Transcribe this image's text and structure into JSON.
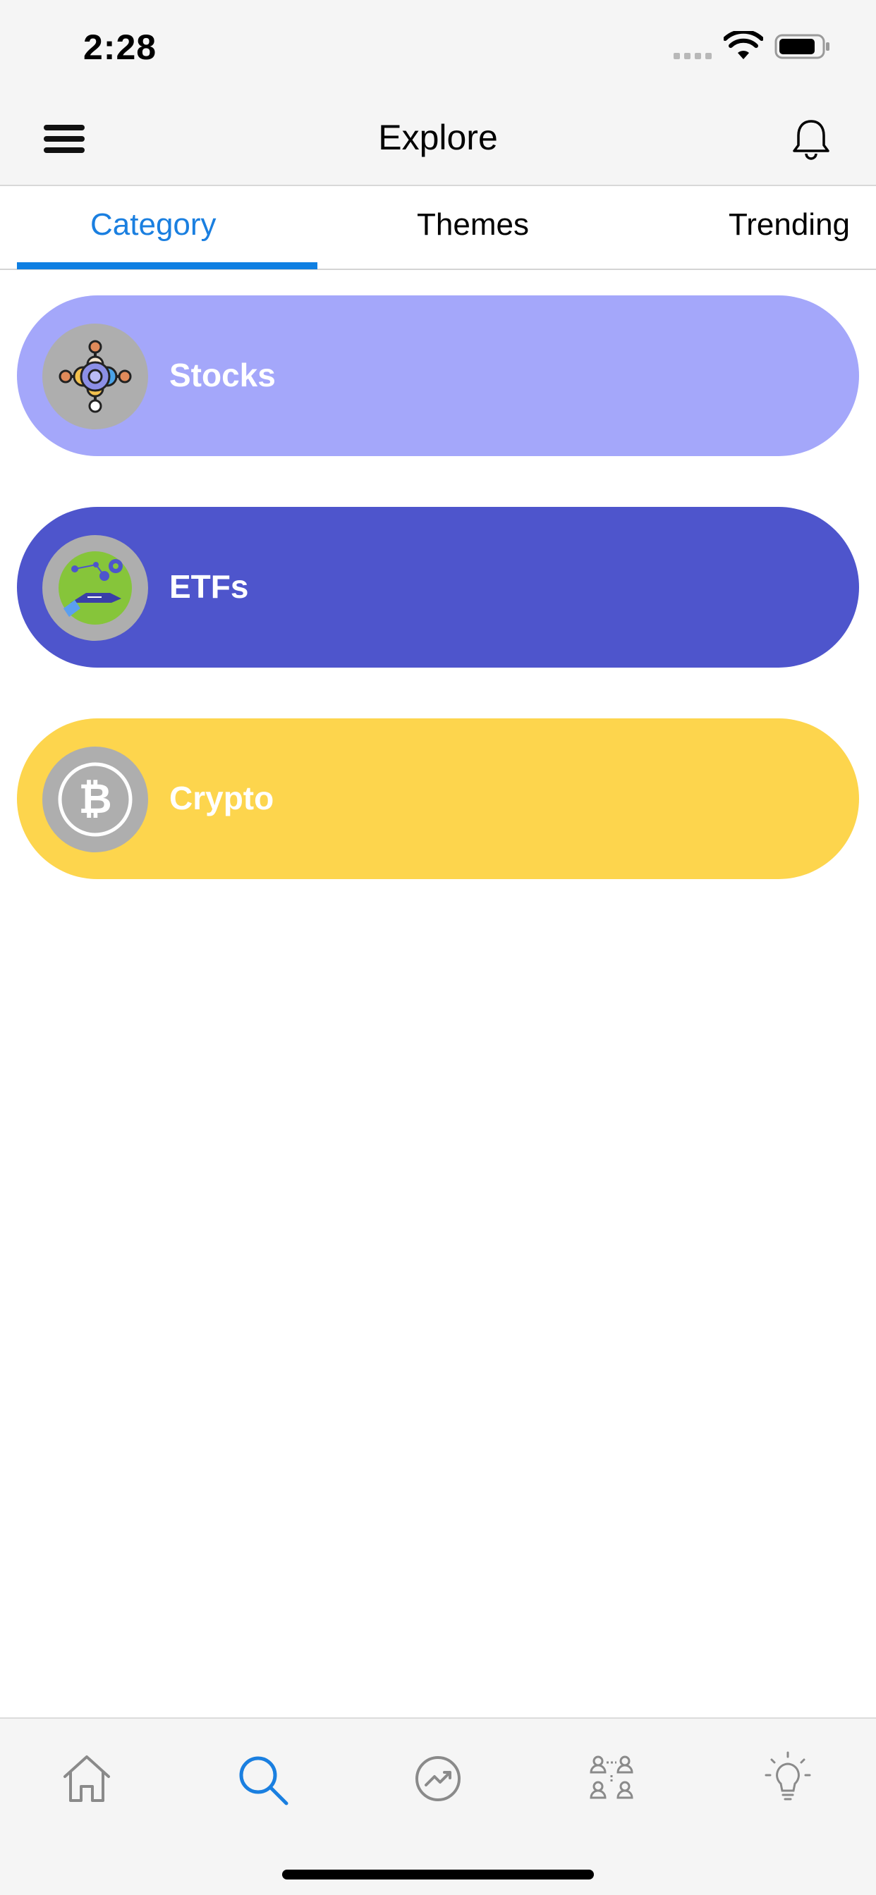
{
  "status_bar": {
    "time": "2:28"
  },
  "header": {
    "title": "Explore"
  },
  "tabs": [
    {
      "label": "Category",
      "active": true
    },
    {
      "label": "Themes",
      "active": false
    },
    {
      "label": "Trending",
      "active": false
    }
  ],
  "categories": [
    {
      "label": "Stocks",
      "color": "#a4a7fa",
      "icon": "stocks-network-icon"
    },
    {
      "label": "ETFs",
      "color": "#4e55cc",
      "icon": "etf-hand-icon"
    },
    {
      "label": "Crypto",
      "color": "#fdd54d",
      "icon": "bitcoin-icon"
    }
  ],
  "bottom_nav": [
    {
      "name": "home",
      "icon": "home-icon",
      "active": false
    },
    {
      "name": "explore",
      "icon": "search-icon",
      "active": true
    },
    {
      "name": "trends",
      "icon": "trending-icon",
      "active": false
    },
    {
      "name": "community",
      "icon": "people-network-icon",
      "active": false
    },
    {
      "name": "ideas",
      "icon": "lightbulb-icon",
      "active": false
    }
  ],
  "colors": {
    "accent": "#1a7fe0",
    "inactive_icon": "#8a8a8a"
  }
}
